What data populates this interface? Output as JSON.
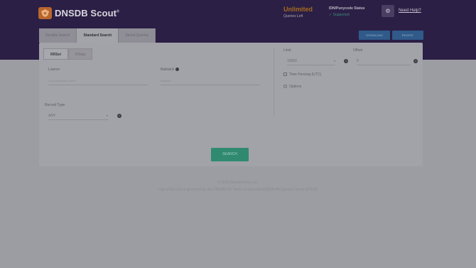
{
  "header": {
    "brand": "DNSDB Scout",
    "brand_mark": "®",
    "quota_value": "Unlimited",
    "quota_label": "Queries Left",
    "status_label": "IDN/Punycode Status",
    "status_value": "✓ Supported",
    "settings_icon": "gear-icon",
    "help_link": "Need Help?",
    "tabs": [
      {
        "label": "Flexible Search",
        "active": false
      },
      {
        "label": "Standard Search",
        "active": true
      },
      {
        "label": "Saved Queries",
        "active": false
      }
    ],
    "buttons": [
      "DOWNLOAD",
      "RECENT"
    ]
  },
  "search": {
    "subtabs": [
      {
        "label": "RRSet",
        "active": true
      },
      {
        "label": "RData",
        "active": false
      }
    ],
    "owner_name": {
      "label": "Lowner",
      "placeholder": "Lookup domain name"
    },
    "bailiwick": {
      "label": "Bailiwick",
      "placeholder": "bailiwick"
    },
    "record_type": {
      "label": "Record Type",
      "value": "ANY"
    },
    "limit": {
      "label": "Limit",
      "value": "10000"
    },
    "offset": {
      "label": "Offset",
      "value": "0"
    },
    "time_fencing": "Time Fencing (UTC)",
    "options": "Options",
    "search_button": "SEARCH"
  },
  "footer": {
    "copyright": "© 2020 DomainTools, Inc.",
    "terms": "Use of this tool is governed by the DNSDB API Terms of Use and DNSDB API Service Terms (DTOS)"
  },
  "colors": {
    "header_bg": "#2b1f45",
    "quota_accent": "#a76a1f",
    "search_button": "#2f8a6f",
    "header_button": "#2f5a8a"
  }
}
